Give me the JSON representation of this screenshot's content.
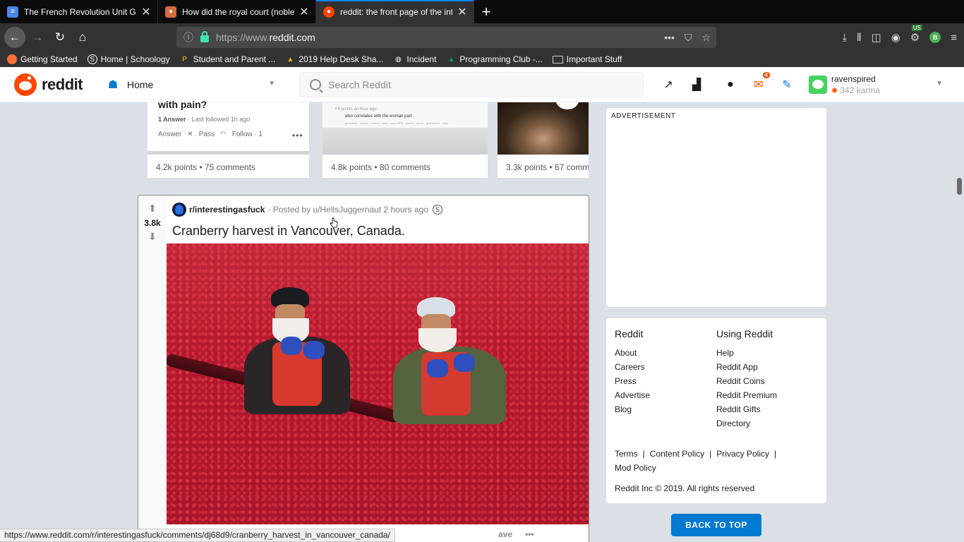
{
  "browser": {
    "tabs": [
      {
        "title": "The French Revolution Unit Gui",
        "favicon": "google-docs-icon",
        "color": "#4a86e8"
      },
      {
        "title": "How did the royal court (noble",
        "favicon": "quora-icon",
        "color": "#d46a3a"
      },
      {
        "title": "reddit: the front page of the int",
        "favicon": "reddit-icon",
        "color": "#ff4500"
      }
    ],
    "url_prefix": "https://www.",
    "url_host": "reddit.com",
    "ext_badge": "US",
    "ext_letter": "B",
    "bookmarks": [
      {
        "label": "Getting Started",
        "icon": "firefox-icon"
      },
      {
        "label": "Home | Schoology",
        "icon": "schoology-icon"
      },
      {
        "label": "Student and Parent ...",
        "icon": "bookmark-icon"
      },
      {
        "label": "2019 Help Desk Sha...",
        "icon": "google-drive-icon"
      },
      {
        "label": "Incident",
        "icon": "globe-icon"
      },
      {
        "label": "Programming Club -...",
        "icon": "google-drive-icon"
      },
      {
        "label": "Important Stuff",
        "icon": "folder-icon"
      }
    ],
    "status_url": "https://www.reddit.com/r/interestingasfuck/comments/dj68d9/cranberry_harvest_in_vancouver_canada/"
  },
  "header": {
    "wordmark": "reddit",
    "feed_label": "Home",
    "search_placeholder": "Search Reddit",
    "mail_count": "4",
    "username": "ravenspired",
    "karma": "342 karma"
  },
  "cards": [
    {
      "title": "with pain?",
      "meta_count": "1 Answer",
      "meta_rest": " · Last followed 1h ago",
      "actions": [
        "Answer",
        "Pass",
        "Follow · 1"
      ],
      "stats": "4.2k points • 75 comments"
    },
    {
      "shot_line1": "• 8 points an hour ago",
      "shot_line2": "also correlates with the woman part",
      "stats": "4.8k points • 80 comments"
    },
    {
      "stats": "3.3k points • 67 comments"
    }
  ],
  "post": {
    "score": "3.8k",
    "subreddit": "r/interestingasfuck",
    "posted_by": "· Posted by u/HellsJuggernaut 2 hours ago",
    "title": "Cranberry harvest in Vancouver, Canada.",
    "foot_save": "ave",
    "foot_more": "•••"
  },
  "sidebar": {
    "ad_label": "ADVERTISEMENT",
    "col1_heading": "Reddit",
    "col1_links": [
      "About",
      "Careers",
      "Press",
      "Advertise",
      "Blog"
    ],
    "col2_heading": "Using Reddit",
    "col2_links": [
      "Help",
      "Reddit App",
      "Reddit Coins",
      "Reddit Premium",
      "Reddit Gifts",
      "Directory"
    ],
    "legal": [
      "Terms",
      "Content Policy",
      "Privacy Policy",
      "Mod Policy"
    ],
    "copyright": "Reddit Inc © 2019. All rights reserved",
    "back_to_top": "BACK TO TOP"
  }
}
